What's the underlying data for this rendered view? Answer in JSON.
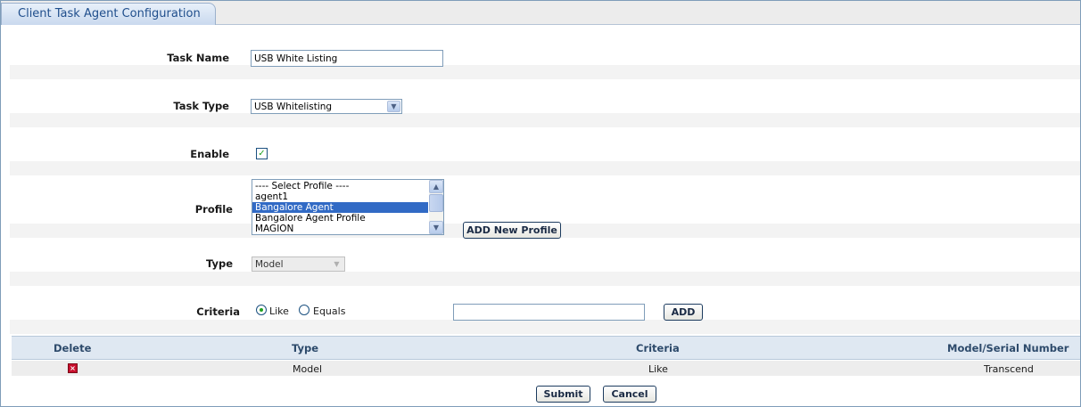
{
  "tab": {
    "title": "Client Task Agent Configuration"
  },
  "form": {
    "task_name": {
      "label": "Task Name",
      "value": "USB White Listing"
    },
    "task_type": {
      "label": "Task Type",
      "value": "USB Whitelisting"
    },
    "enable": {
      "label": "Enable",
      "checked": true
    },
    "profile": {
      "label": "Profile",
      "options": [
        "---- Select Profile ----",
        "agent1",
        "Bangalore Agent",
        "Bangalore Agent Profile",
        "MAGION"
      ],
      "selected": "Bangalore Agent",
      "add_button": "ADD New Profile"
    },
    "type": {
      "label": "Type",
      "value": "Model"
    },
    "criteria": {
      "label": "Criteria",
      "like_label": "Like",
      "equals_label": "Equals",
      "selected": "Like",
      "value": "",
      "add_button": "ADD"
    }
  },
  "table": {
    "columns": [
      "Delete",
      "Type",
      "Criteria",
      "Model/Serial Number"
    ],
    "rows": [
      {
        "type": "Model",
        "criteria": "Like",
        "model_serial": "Transcend"
      }
    ]
  },
  "footer": {
    "submit": "Submit",
    "cancel": "Cancel"
  },
  "colors": {
    "accent": "#316ac5",
    "table_header": "#dfe8f2",
    "delete_icon": "#c8102e"
  }
}
